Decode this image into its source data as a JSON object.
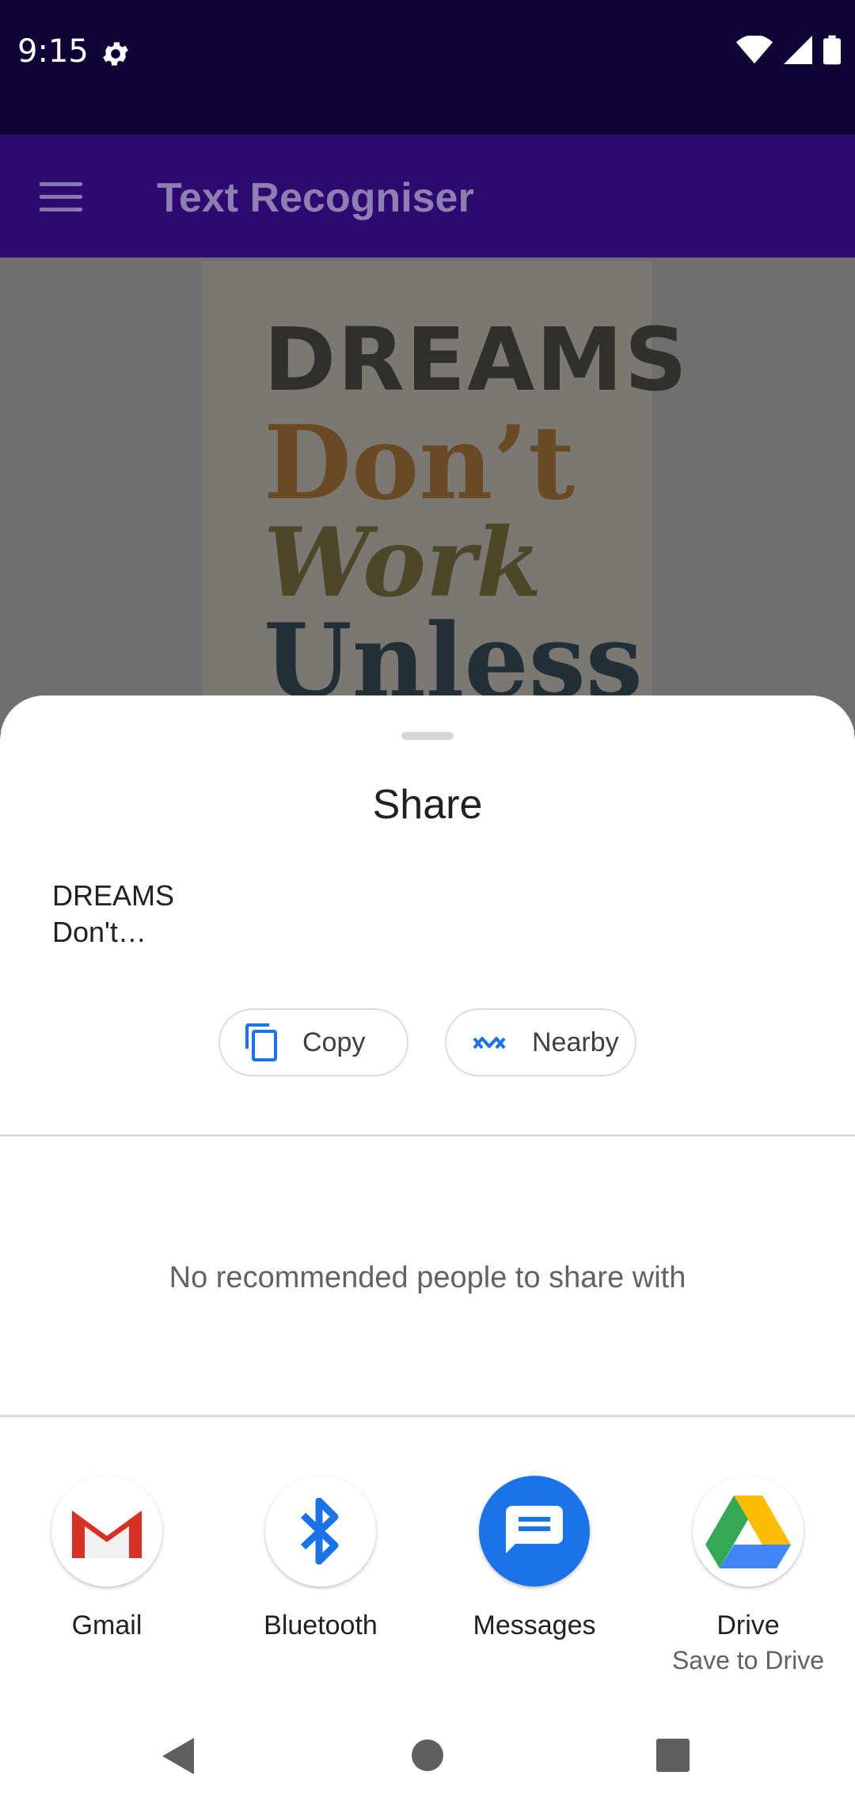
{
  "status_bar": {
    "time": "9:15",
    "icons": [
      "settings-icon",
      "wifi-icon",
      "signal-icon",
      "battery-icon"
    ]
  },
  "app_bar": {
    "title": "Text Recogniser",
    "menu_icon": "hamburger-menu-icon"
  },
  "background_image": {
    "lines": [
      "DREAMS",
      "Don’t",
      "Work",
      "Unless"
    ]
  },
  "share_sheet": {
    "title": "Share",
    "preview_text": "DREAMS\nDon't…",
    "actions": [
      {
        "label": "Copy",
        "icon": "copy-icon"
      },
      {
        "label": "Nearby",
        "icon": "nearby-share-icon"
      }
    ],
    "no_people_text": "No recommended people to share with",
    "apps": [
      {
        "label": "Gmail",
        "sublabel": "",
        "icon": "gmail-icon"
      },
      {
        "label": "Bluetooth",
        "sublabel": "",
        "icon": "bluetooth-icon"
      },
      {
        "label": "Messages",
        "sublabel": "",
        "icon": "messages-icon"
      },
      {
        "label": "Drive",
        "sublabel": "Save to Drive",
        "icon": "drive-icon"
      }
    ]
  },
  "nav_bar": {
    "buttons": [
      "back-icon",
      "home-icon",
      "recents-icon"
    ]
  },
  "colors": {
    "status_bar": "#0e0435",
    "app_bar": "#2d0a70",
    "accent_blue": "#1a73e8",
    "divider": "#dadce0"
  }
}
